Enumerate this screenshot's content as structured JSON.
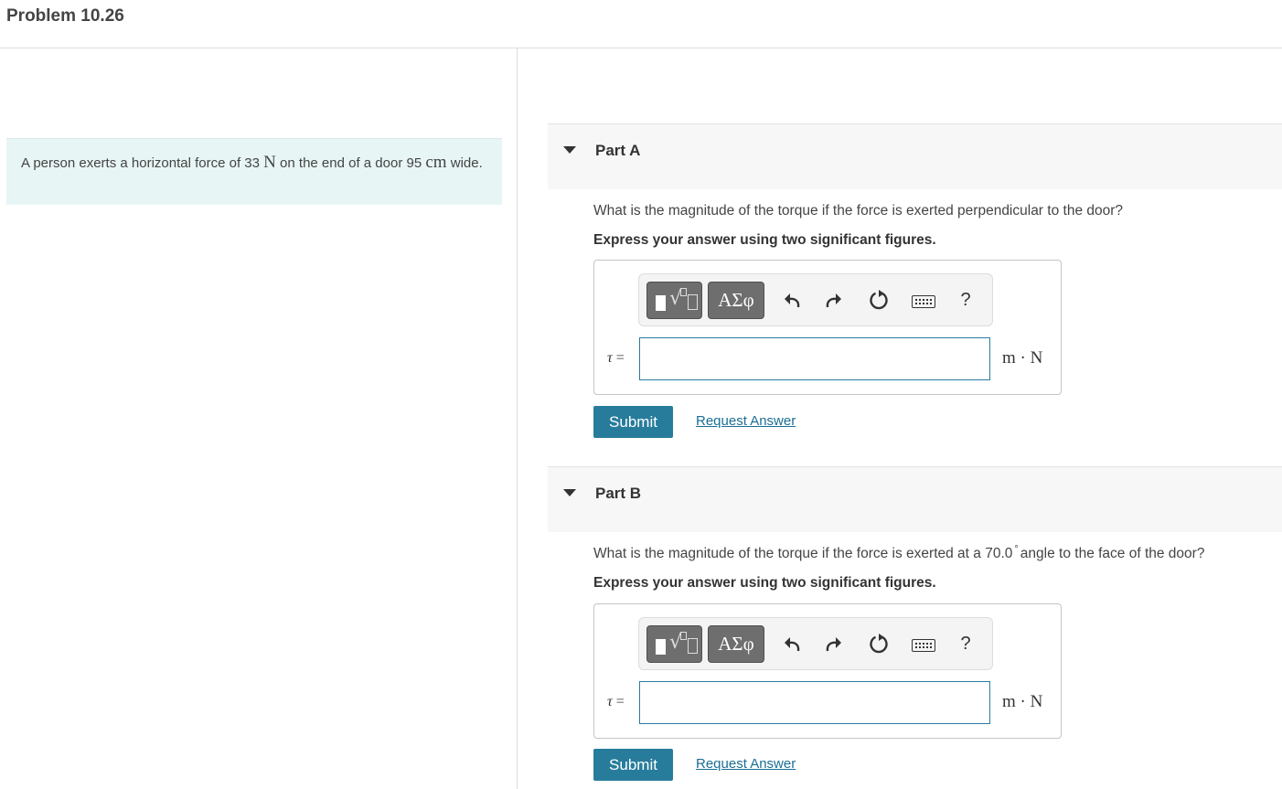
{
  "header": {
    "title": "Problem 10.26"
  },
  "problem": {
    "text_1": "A person exerts a horizontal force of 33 ",
    "force_unit": "N",
    "text_2": " on the end of a door 95 ",
    "length_unit": "cm",
    "text_3": " wide."
  },
  "parts": [
    {
      "title": "Part A",
      "question": "What is the magnitude of the torque if the force is exerted perpendicular to the door?",
      "instruction": "Express your answer using two significant figures.",
      "toolbar": {
        "greek_label": "ΑΣφ",
        "help_label": "?"
      },
      "variable": "τ",
      "equals": " =",
      "input_value": "",
      "units": "m · N",
      "submit_label": "Submit",
      "request_label": "Request Answer"
    },
    {
      "title": "Part B",
      "question_pre": "What is the magnitude of the torque if the force is exerted at a 70.0",
      "question_degree": "°",
      "question_post": "angle to the face of the door?",
      "instruction": "Express your answer using two significant figures.",
      "toolbar": {
        "greek_label": "ΑΣφ",
        "help_label": "?"
      },
      "variable": "τ",
      "equals": " =",
      "input_value": "",
      "units": "m · N",
      "submit_label": "Submit",
      "request_label": "Request Answer"
    }
  ],
  "icons": {
    "caret": "caret-down-icon",
    "templates": "templates-icon",
    "undo": "undo-icon",
    "redo": "redo-icon",
    "reset": "reset-icon",
    "keyboard": "keyboard-icon",
    "help": "help-icon"
  },
  "colors": {
    "accent": "#277c9b",
    "link": "#1a6f93",
    "problem_bg": "#e8f5f5",
    "input_border": "#2a7ba0"
  }
}
